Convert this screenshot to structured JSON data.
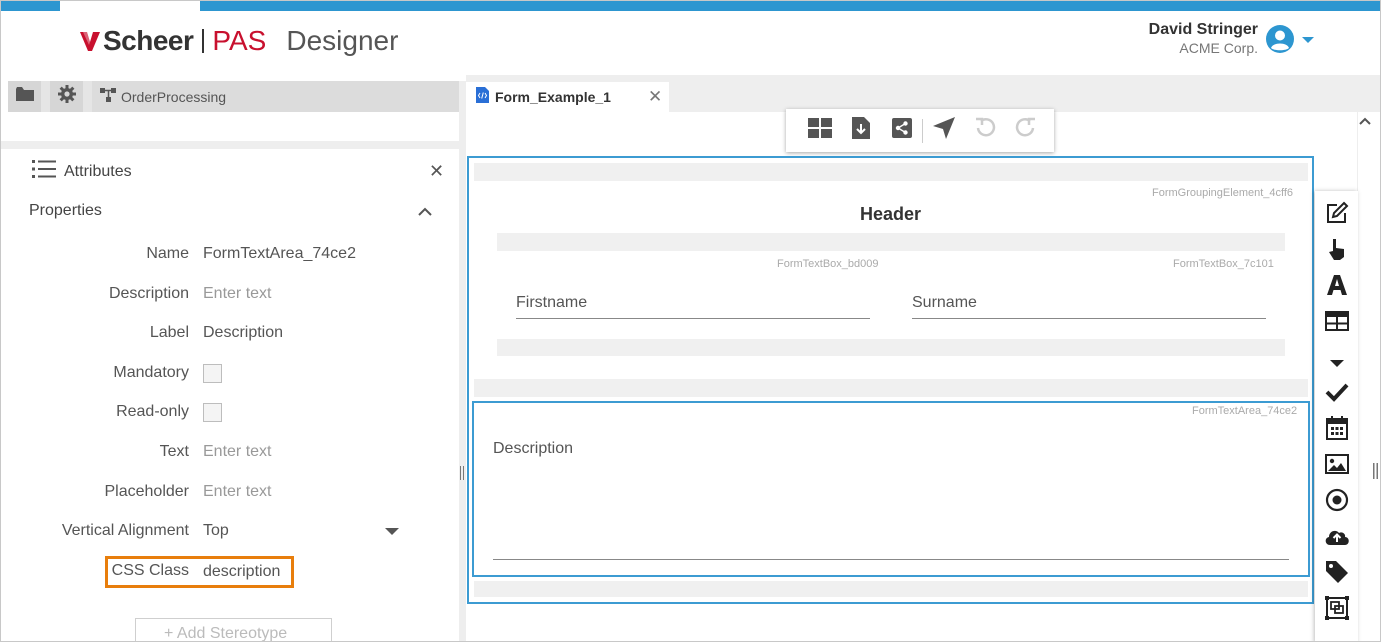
{
  "header": {
    "logo_scheer": "Scheer",
    "logo_pas": "PAS",
    "app_name": "Designer",
    "user_name": "David Stringer",
    "user_company": "ACME Corp."
  },
  "left_toolbar": {
    "breadcrumb": "OrderProcessing"
  },
  "attributes": {
    "title": "Attributes",
    "section": "Properties",
    "fields": {
      "name": {
        "label": "Name",
        "value": "FormTextArea_74ce2"
      },
      "description": {
        "label": "Description",
        "placeholder": "Enter text"
      },
      "label": {
        "label": "Label",
        "value": "Description"
      },
      "mandatory": {
        "label": "Mandatory",
        "checked": false
      },
      "readonly": {
        "label": "Read-only",
        "checked": false
      },
      "text": {
        "label": "Text",
        "placeholder": "Enter text"
      },
      "placeholder": {
        "label": "Placeholder",
        "placeholder": "Enter text"
      },
      "vertical_alignment": {
        "label": "Vertical Alignment",
        "value": "Top"
      },
      "css_class": {
        "label": "CSS Class",
        "value": "description"
      }
    },
    "add_stereotype": "+ Add Stereotype"
  },
  "editor": {
    "tab_title": "Form_Example_1",
    "grouping_id": "FormGroupingElement_4cff6",
    "form_header": "Header",
    "textbox1_id": "FormTextBox_bd009",
    "textbox2_id": "FormTextBox_7c101",
    "firstname_label": "Firstname",
    "surname_label": "Surname",
    "textarea_id": "FormTextArea_74ce2",
    "textarea_label": "Description"
  },
  "colors": {
    "accent_blue": "#2d96d0",
    "selection_blue": "#3c9bd2",
    "highlight_orange": "#e87e0c",
    "brand_red": "#c8102e"
  },
  "icons": {
    "toolbar": [
      "layout-icon",
      "download-icon",
      "share-icon",
      "navigate-icon",
      "undo-icon",
      "redo-icon"
    ],
    "palette": [
      "edit-icon",
      "pointer-icon",
      "text-icon",
      "table-icon",
      "dropdown-icon",
      "checkmark-icon",
      "calendar-icon",
      "image-icon",
      "radio-icon",
      "upload-icon",
      "tag-icon",
      "group-icon"
    ]
  }
}
